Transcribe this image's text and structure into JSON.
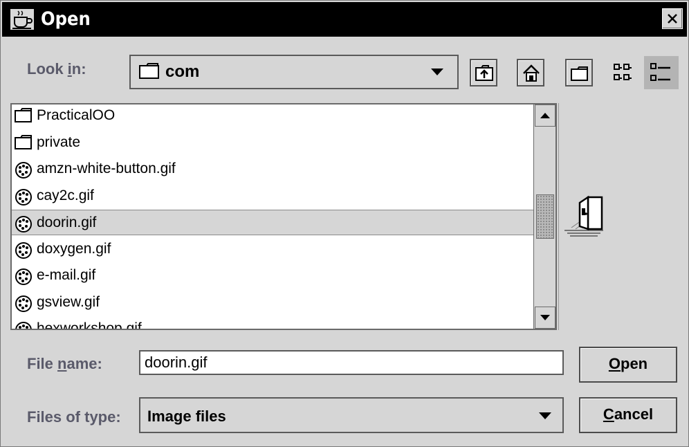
{
  "window": {
    "title": "Open"
  },
  "look_in": {
    "label_pre": "Look ",
    "label_mnemonic": "i",
    "label_post": "n:",
    "value": "com"
  },
  "toolbar": {
    "icons": [
      "up-one-level-icon",
      "home-icon",
      "new-folder-icon",
      "list-view-icon",
      "details-view-icon"
    ],
    "selected_view": "details-view-icon"
  },
  "files": [
    {
      "name": "PracticalOO",
      "type": "folder"
    },
    {
      "name": "private",
      "type": "folder"
    },
    {
      "name": "amzn-white-button.gif",
      "type": "image"
    },
    {
      "name": "cay2c.gif",
      "type": "image"
    },
    {
      "name": "doorin.gif",
      "type": "image",
      "selected": true
    },
    {
      "name": "doxygen.gif",
      "type": "image"
    },
    {
      "name": "e-mail.gif",
      "type": "image"
    },
    {
      "name": "gsview.gif",
      "type": "image"
    },
    {
      "name": "hexworkshop.gif",
      "type": "image"
    }
  ],
  "file_name": {
    "label_pre": "File ",
    "label_mnemonic": "n",
    "label_post": "ame:",
    "value": "doorin.gif"
  },
  "files_of_type": {
    "label": "Files of type:",
    "value": "Image files"
  },
  "buttons": {
    "open_mnemonic": "O",
    "open_rest": "pen",
    "cancel_mnemonic": "C",
    "cancel_rest": "ancel"
  },
  "colors": {
    "panel": "#d6d6d6",
    "titlebar": "#000000",
    "label": "#5a5a6a"
  }
}
